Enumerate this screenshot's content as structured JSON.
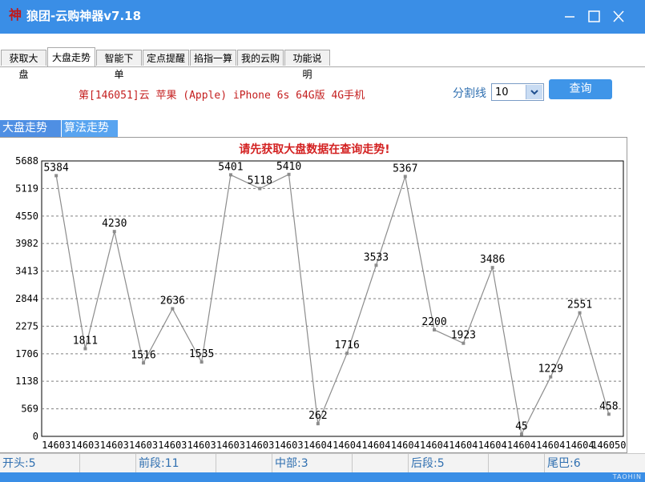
{
  "window": {
    "icon_glyph": "神",
    "title": "狼团-云购神器v7.18",
    "controls": [
      "minimize-icon",
      "maximize-icon",
      "close-icon"
    ]
  },
  "tabs": [
    {
      "label": "获取大盘",
      "active": false
    },
    {
      "label": "大盘走势",
      "active": true
    },
    {
      "label": "智能下单",
      "active": false
    },
    {
      "label": "定点提醒",
      "active": false
    },
    {
      "label": "掐指一算",
      "active": false
    },
    {
      "label": "我的云购",
      "active": false
    },
    {
      "label": "功能说明",
      "active": false
    }
  ],
  "product": {
    "title": "第[146051]云  苹果 (Apple) iPhone 6s 64G版 4G手机"
  },
  "divider": {
    "label": "分割线",
    "selected": "10"
  },
  "query_button": "查询",
  "subtabs": [
    {
      "label": "大盘走势",
      "active": true
    },
    {
      "label": "算法走势",
      "active": false
    }
  ],
  "chart_message": "请先获取大盘数据在查询走势!",
  "chart_data": {
    "type": "line",
    "title": "",
    "xlabel": "",
    "ylabel": "",
    "ylim": [
      0,
      5688
    ],
    "y_ticks": [
      0,
      569,
      1138,
      1706,
      2275,
      2844,
      3413,
      3982,
      4550,
      5119,
      5688
    ],
    "grid": true,
    "x": [
      "146031",
      "146032",
      "146033",
      "146034",
      "146035",
      "146036",
      "146037",
      "146038",
      "146039",
      "146040",
      "146041",
      "146042",
      "146043",
      "146044",
      "146045",
      "146046",
      "146047",
      "146048",
      "146049",
      "146050"
    ],
    "x_tick_labels": [
      "14603",
      "14603",
      "14603",
      "14603",
      "14603",
      "14603",
      "14603",
      "14603",
      "14603",
      "14604",
      "14604",
      "14604",
      "14604",
      "14604",
      "14604",
      "14604",
      "14604",
      "14604",
      "14604",
      "146050"
    ],
    "series": [
      {
        "values": [
          5384,
          1811,
          4230,
          1516,
          2636,
          1535,
          5401,
          5118,
          5410,
          262,
          1716,
          3533,
          5367,
          2200,
          1923,
          3486,
          45,
          1229,
          2551,
          458
        ]
      }
    ],
    "colors": {
      "line": "#8c8c8c",
      "point": "#8c8c8c",
      "grid": "#7f7f7f",
      "labels": "#000000"
    }
  },
  "status": [
    {
      "label": "开头:5"
    },
    {
      "label": ""
    },
    {
      "label": "前段:11"
    },
    {
      "label": ""
    },
    {
      "label": "中部:3"
    },
    {
      "label": ""
    },
    {
      "label": "后段:5"
    },
    {
      "label": ""
    },
    {
      "label": "尾巴:6"
    }
  ],
  "watermark": "TAOHIN",
  "colors": {
    "titlebar": "#3a8ee6",
    "subtab_active": "#4f8fe3",
    "subtab_inactive": "#58a4f0",
    "product_title": "#c41f1f",
    "status_text": "#2f6fb0"
  }
}
